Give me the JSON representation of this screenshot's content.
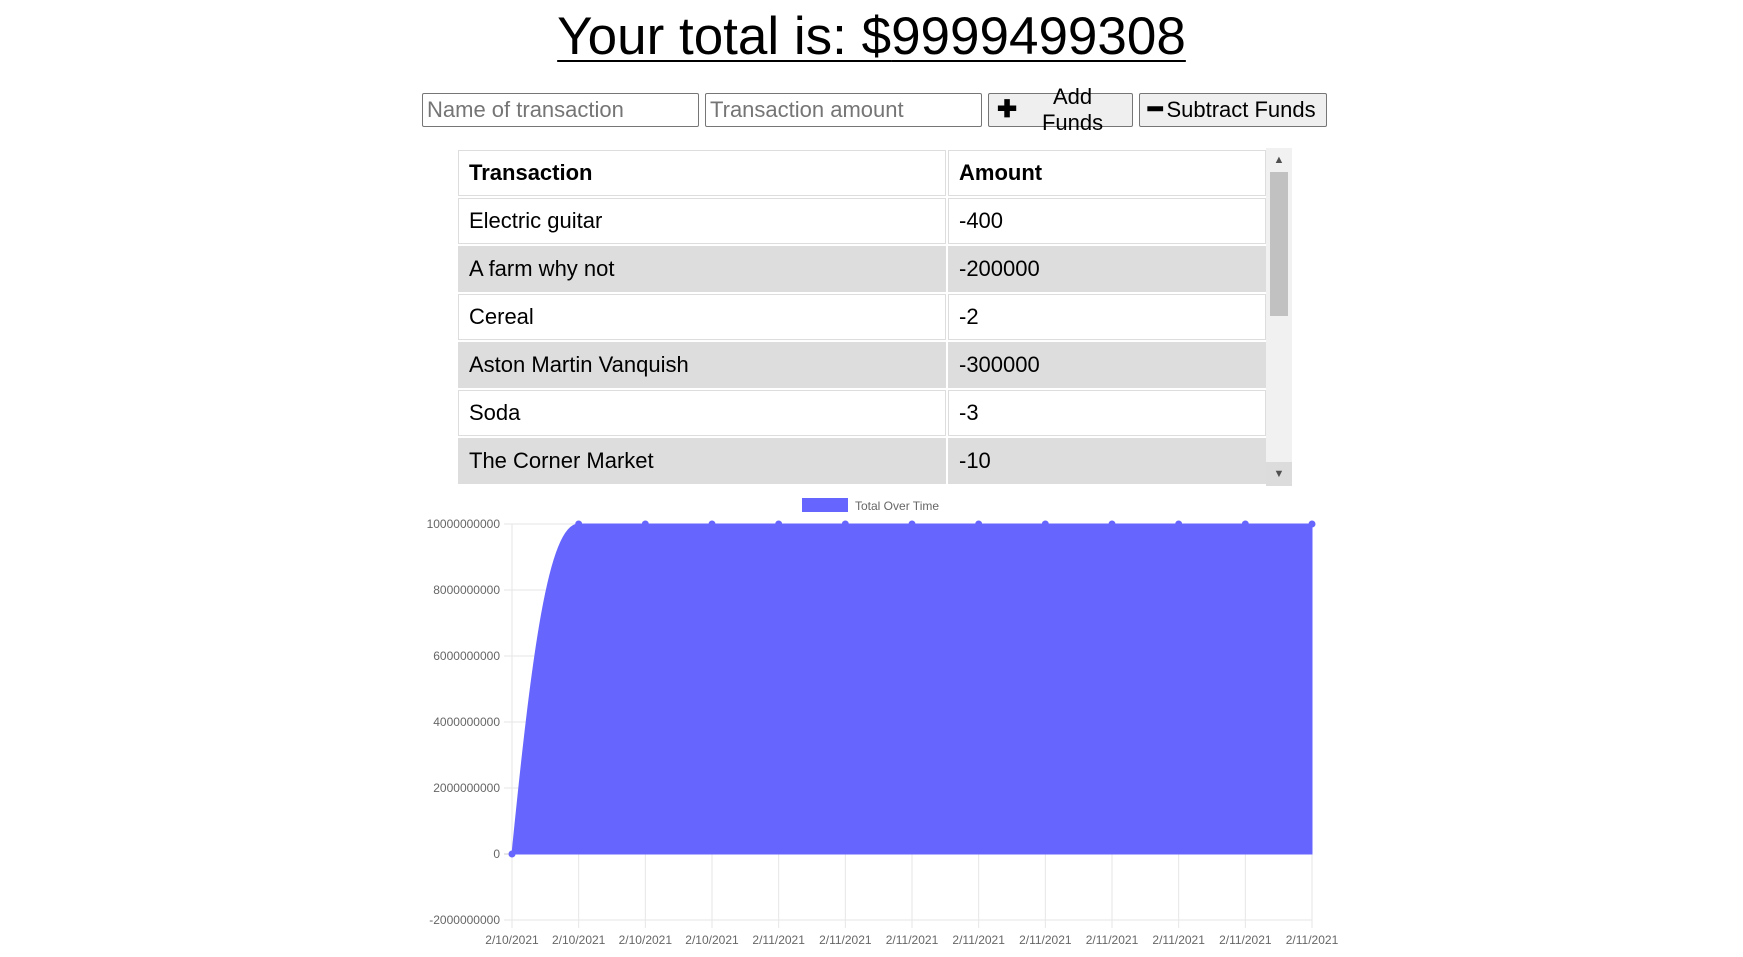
{
  "header": {
    "total_prefix": "Your total is: $",
    "total_value": "9999499308"
  },
  "form": {
    "name_placeholder": "Name of transaction",
    "amount_placeholder": "Transaction amount",
    "add_label": "Add Funds",
    "subtract_label": "Subtract Funds",
    "add_icon": "plus-icon",
    "subtract_icon": "minus-icon"
  },
  "table": {
    "headers": [
      "Transaction",
      "Amount"
    ],
    "rows": [
      {
        "name": "Electric guitar",
        "amount": "-400"
      },
      {
        "name": "A farm why not",
        "amount": "-200000"
      },
      {
        "name": "Cereal",
        "amount": "-2"
      },
      {
        "name": "Aston Martin Vanquish",
        "amount": "-300000"
      },
      {
        "name": "Soda",
        "amount": "-3"
      },
      {
        "name": "The Corner Market",
        "amount": "-10"
      }
    ]
  },
  "chart_data": {
    "type": "area",
    "legend": "Total Over Time",
    "legend_position": "top",
    "color": "#6666ff",
    "x": [
      "2/10/2021",
      "2/10/2021",
      "2/10/2021",
      "2/10/2021",
      "2/11/2021",
      "2/11/2021",
      "2/11/2021",
      "2/11/2021",
      "2/11/2021",
      "2/11/2021",
      "2/11/2021",
      "2/11/2021",
      "2/11/2021"
    ],
    "values": [
      0,
      10000000000,
      10000000000,
      10000000000,
      10000000000,
      10000000000,
      10000000000,
      10000000000,
      10000000000,
      10000000000,
      10000000000,
      10000000000,
      9999499308
    ],
    "yticks": [
      10000000000,
      8000000000,
      6000000000,
      4000000000,
      2000000000,
      0,
      -2000000000
    ],
    "ylim": [
      -2000000000,
      10000000000
    ],
    "grid": true
  }
}
